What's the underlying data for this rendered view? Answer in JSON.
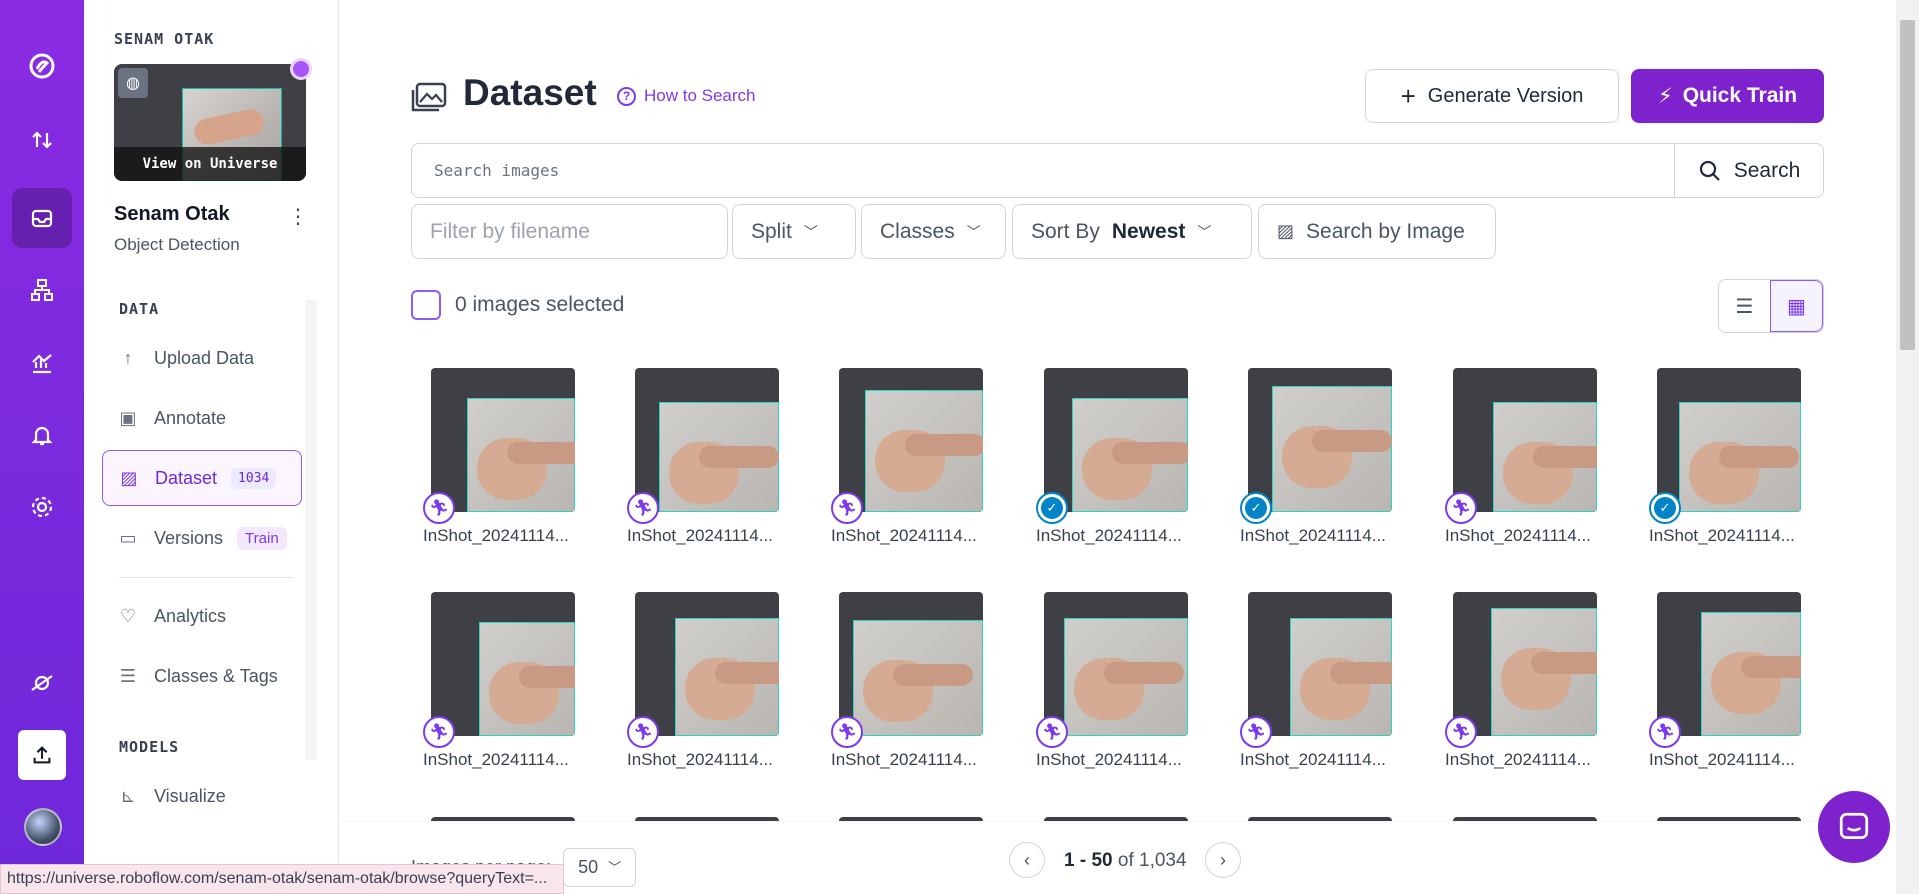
{
  "workspace": {
    "label": "SENAM OTAK",
    "view_on_universe": "View on Universe",
    "project_name": "Senam Otak",
    "project_type": "Object Detection"
  },
  "sidebar": {
    "data_heading": "DATA",
    "items": [
      {
        "label": "Upload Data",
        "icon": "upload-arrow-icon"
      },
      {
        "label": "Annotate",
        "icon": "annotate-icon"
      },
      {
        "label": "Dataset",
        "icon": "dataset-image-icon",
        "badge": "1034"
      },
      {
        "label": "Versions",
        "icon": "versions-folder-icon",
        "badge": "Train"
      },
      {
        "label": "Analytics",
        "icon": "analytics-heart-icon"
      },
      {
        "label": "Classes & Tags",
        "icon": "list-icon"
      }
    ],
    "models_heading": "MODELS",
    "models_items": [
      {
        "label": "Visualize",
        "icon": "chart-icon"
      }
    ]
  },
  "header": {
    "title": "Dataset",
    "how_to_search": "How to Search",
    "generate_version": "Generate Version",
    "quick_train": "Quick Train"
  },
  "search": {
    "placeholder": "Search images",
    "button": "Search",
    "filename_placeholder": "Filter by filename",
    "split": "Split",
    "classes": "Classes",
    "sort_by": "Sort By",
    "sort_value": "Newest",
    "search_by_image": "Search by Image"
  },
  "selection": {
    "text": "0 images selected"
  },
  "images": [
    {
      "name": "InShot_20241114...",
      "status": "annotate"
    },
    {
      "name": "InShot_20241114...",
      "status": "annotate"
    },
    {
      "name": "InShot_20241114...",
      "status": "annotate"
    },
    {
      "name": "InShot_20241114...",
      "status": "approved"
    },
    {
      "name": "InShot_20241114...",
      "status": "approved"
    },
    {
      "name": "InShot_20241114...",
      "status": "annotate"
    },
    {
      "name": "InShot_20241114...",
      "status": "approved"
    },
    {
      "name": "InShot_20241114...",
      "status": "annotate"
    },
    {
      "name": "InShot_20241114...",
      "status": "annotate"
    },
    {
      "name": "InShot_20241114...",
      "status": "annotate"
    },
    {
      "name": "InShot_20241114...",
      "status": "annotate"
    },
    {
      "name": "InShot_20241114...",
      "status": "annotate"
    },
    {
      "name": "InShot_20241114...",
      "status": "annotate"
    },
    {
      "name": "InShot_20241114...",
      "status": "annotate"
    }
  ],
  "pagination": {
    "per_page_label": "Images per page:",
    "per_page_value": "50",
    "range": "1 - 50",
    "of_label": "of",
    "total": "1,034"
  },
  "status_url": "https://universe.roboflow.com/senam-otak/senam-otak/browse?queryText=...",
  "colors": {
    "brand": "#7e22ce",
    "accent": "#8b5cf6",
    "approved": "#0284c7",
    "bbox": "#2dd4bf"
  }
}
